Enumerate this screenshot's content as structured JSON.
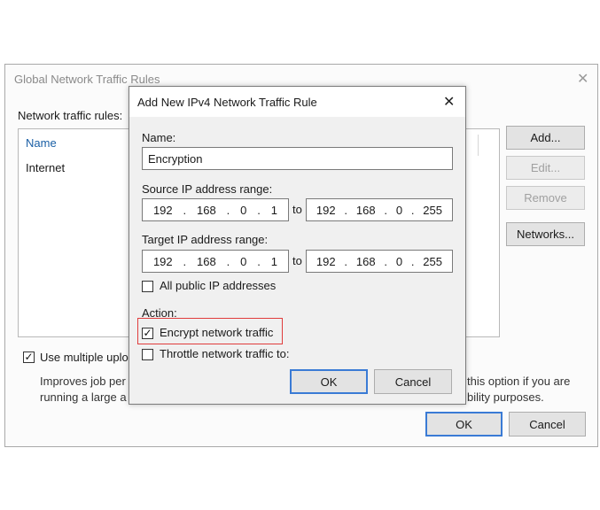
{
  "parent": {
    "title": "Global Network Traffic Rules",
    "close": "✕",
    "rules_label": "Network traffic rules:",
    "column_name": "Name",
    "rows": [
      "Internet"
    ],
    "buttons": {
      "add": "Add...",
      "edit": "Edit...",
      "remove": "Remove",
      "networks": "Networks..."
    },
    "multi_upload_label": "Use multiple uplo",
    "desc_left_1": "Improves job per",
    "desc_left_2": "running a large a",
    "desc_right_1": "this option if you are",
    "desc_right_2": "bility purposes.",
    "ok": "OK",
    "cancel": "Cancel"
  },
  "dialog": {
    "title": "Add New IPv4 Network Traffic Rule",
    "close": "✕",
    "name_label": "Name:",
    "name_value": "Encryption",
    "source_label": "Source IP address range:",
    "source_from": [
      "192",
      "168",
      "0",
      "1"
    ],
    "source_to": [
      "192",
      "168",
      "0",
      "255"
    ],
    "target_label": "Target IP address range:",
    "target_from": [
      "192",
      "168",
      "0",
      "1"
    ],
    "target_to": [
      "192",
      "168",
      "0",
      "255"
    ],
    "to_label": "to",
    "dot": ".",
    "all_public_label": "All public IP addresses",
    "action_label": "Action:",
    "encrypt_label": "Encrypt network traffic",
    "throttle_label": "Throttle network traffic to:",
    "ok": "OK",
    "cancel": "Cancel"
  },
  "colors": {
    "highlight": "#e03c3c",
    "header": "#1a5fa5",
    "default_button_border": "#3a7bd5"
  },
  "checkboxes": {
    "multi_upload": true,
    "all_public": false,
    "encrypt": true,
    "throttle": false
  },
  "check_glyph": "✓"
}
